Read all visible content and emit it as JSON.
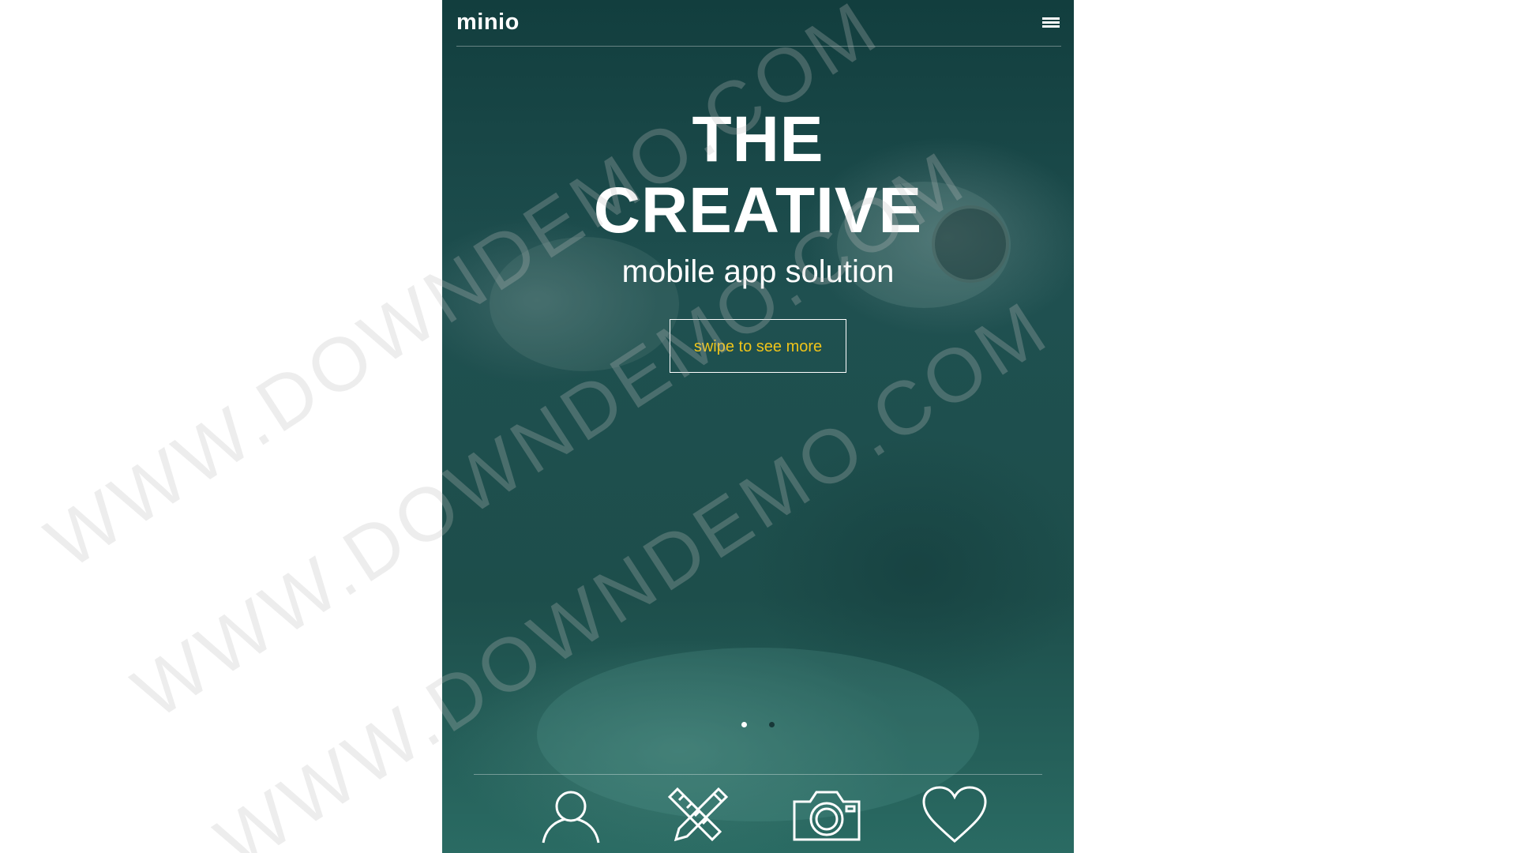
{
  "app": {
    "logo": "minio",
    "hero": {
      "title": "THE CREATIVE",
      "subtitle": "mobile app solution",
      "button_label": "swipe to see more"
    },
    "carousel": {
      "slides": 2,
      "active_index": 0
    },
    "bottom_nav": [
      {
        "icon": "user-icon"
      },
      {
        "icon": "pencil-ruler-icon"
      },
      {
        "icon": "camera-icon"
      },
      {
        "icon": "heart-icon"
      }
    ]
  },
  "watermark": "WWW.DOWNDEMO.COM",
  "colors": {
    "background_overlay": "#1d4e4b",
    "button_text": "#f0c419",
    "text": "#ffffff",
    "page_background": "#ffffff"
  }
}
